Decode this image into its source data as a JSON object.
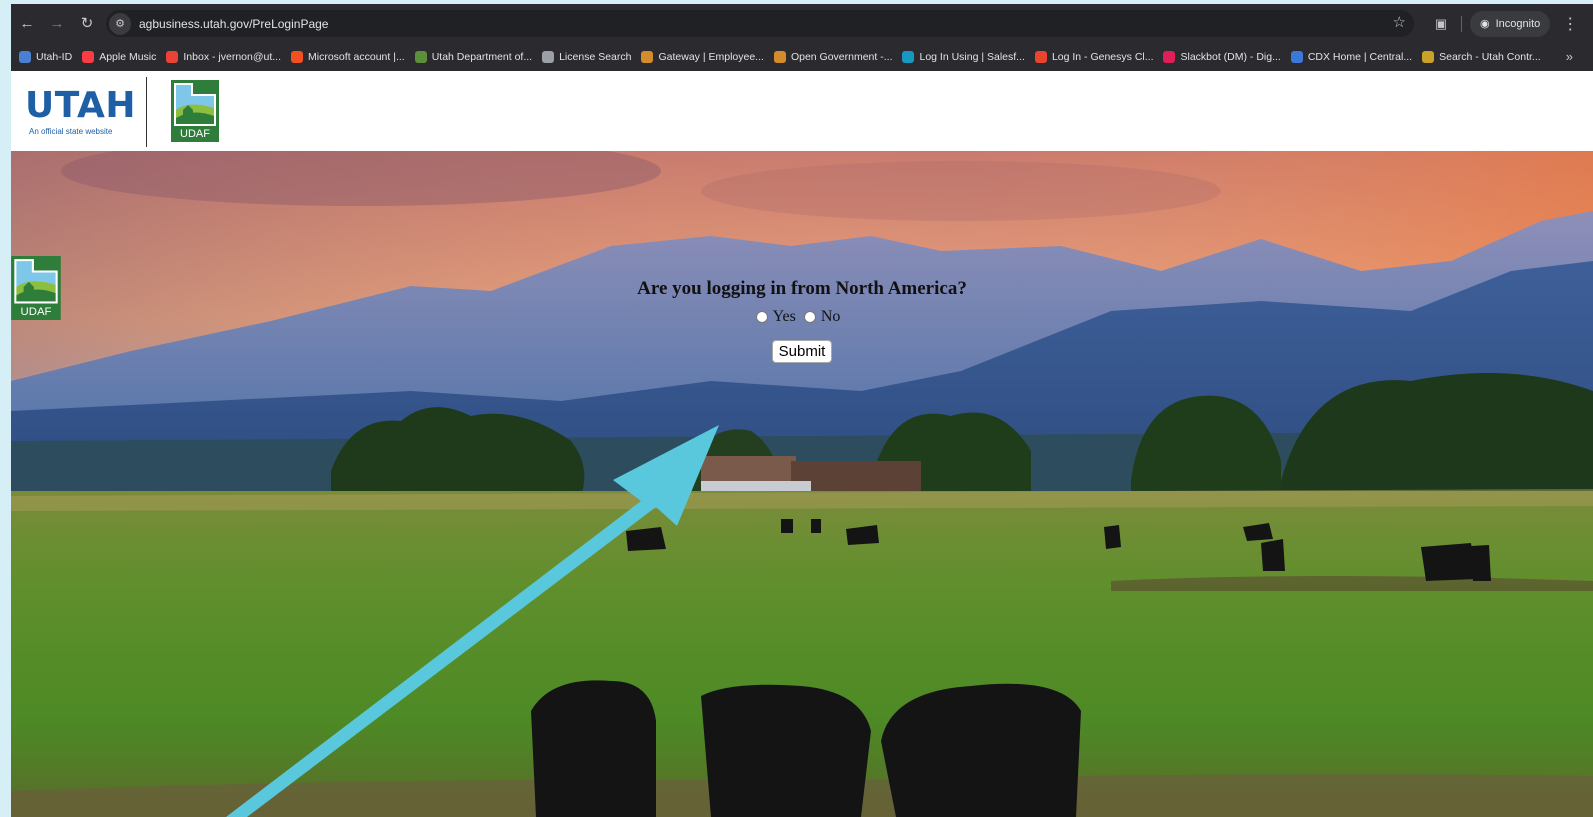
{
  "browser": {
    "url": "agbusiness.utah.gov/PreLoginPage",
    "profile_label": "Incognito",
    "bookmarks": [
      {
        "label": "Utah-ID",
        "color": "#4a7fd4"
      },
      {
        "label": "Apple Music",
        "color": "#fc3c44"
      },
      {
        "label": "Inbox - jvernon@ut...",
        "color": "#ea4335"
      },
      {
        "label": "Microsoft account |...",
        "color": "#f25022"
      },
      {
        "label": "Utah Department of...",
        "color": "#5c8f3a"
      },
      {
        "label": "License Search",
        "color": "#9aa0a6"
      },
      {
        "label": "Gateway | Employee...",
        "color": "#d48b2b"
      },
      {
        "label": "Open Government -...",
        "color": "#d48b2b"
      },
      {
        "label": "Log In Using | Salesf...",
        "color": "#1798c1"
      },
      {
        "label": "Log In - Genesys Cl...",
        "color": "#e8442e"
      },
      {
        "label": "Slackbot (DM) - Dig...",
        "color": "#e01e5a"
      },
      {
        "label": "CDX Home | Central...",
        "color": "#3c78d8"
      },
      {
        "label": "Search - Utah Contr...",
        "color": "#c9a227"
      }
    ]
  },
  "header": {
    "state_logo_word": "UTAH",
    "state_logo_sub": "An official state website",
    "agency_logo_text": "UDAF"
  },
  "login": {
    "logo_text": "UDAF",
    "question": "Are you logging in from North America?",
    "yes_label": "Yes",
    "no_label": "No",
    "submit_label": "Submit"
  },
  "colors": {
    "annotation_arrow": "#5ac8dc",
    "utah_blue": "#1f5fa6",
    "udaf_green": "#2f7d3b"
  }
}
